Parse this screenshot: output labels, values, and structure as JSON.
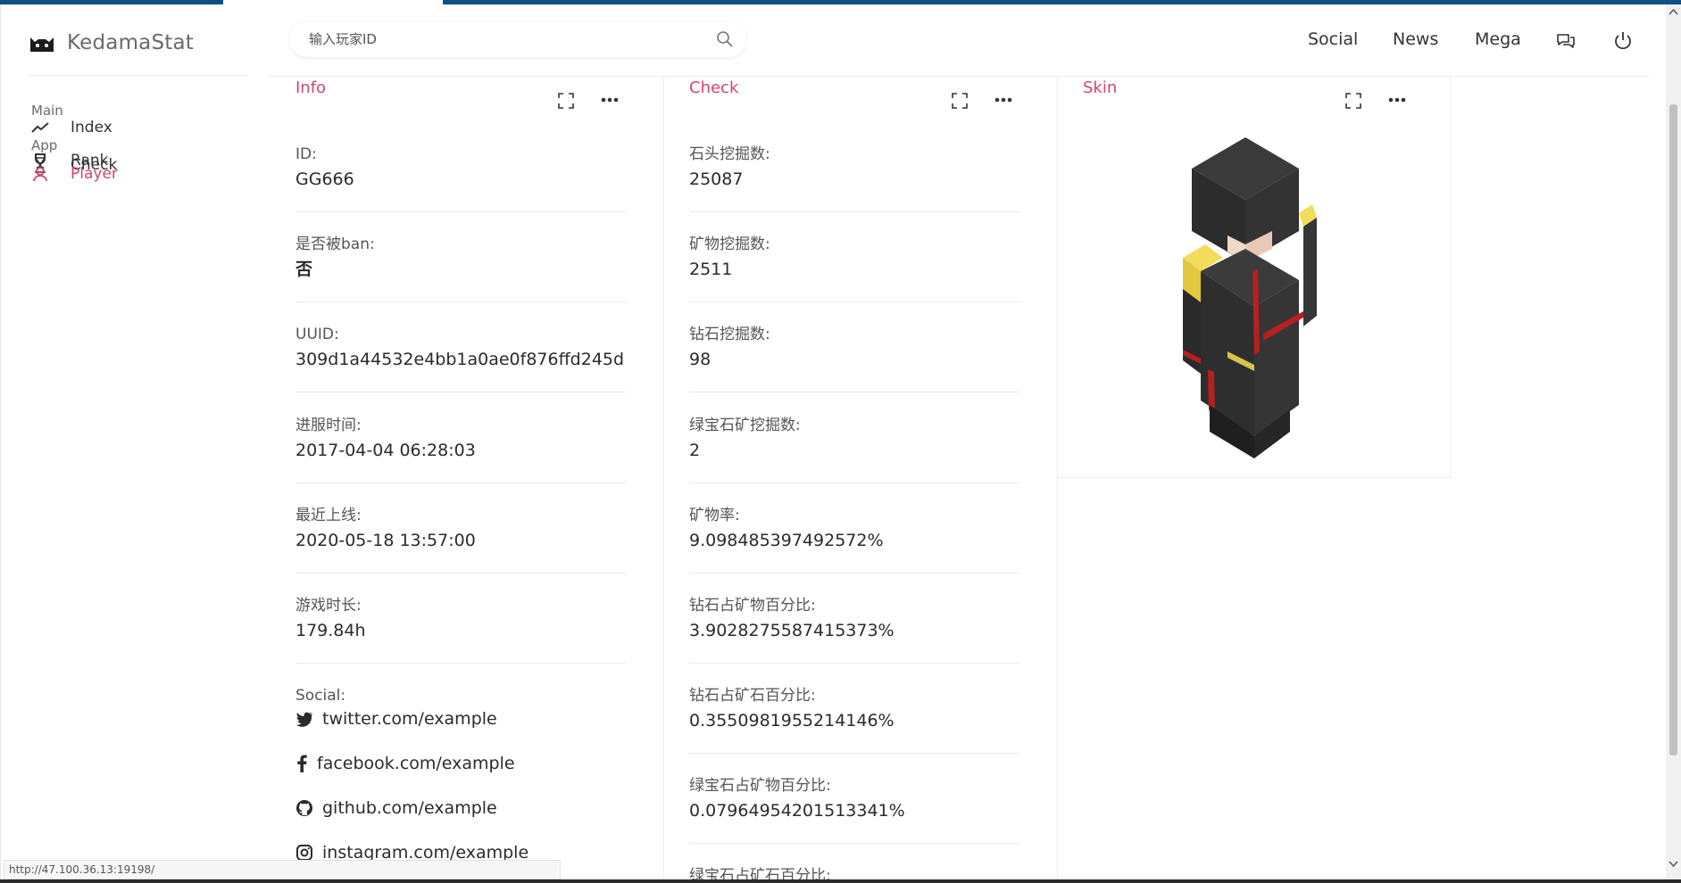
{
  "brand": {
    "name": "KedamaStat"
  },
  "sidebar": {
    "sections": [
      {
        "heading": "Main",
        "items": [
          {
            "label": "Index",
            "icon": "trend-line-icon",
            "active": false
          }
        ]
      },
      {
        "heading": "App",
        "items": [
          {
            "label": "Rank",
            "icon": "trophy-icon",
            "active": false
          },
          {
            "label": "Check",
            "icon": "hourglass-icon",
            "active": false
          },
          {
            "label": "Player",
            "icon": "player-icon",
            "active": true
          }
        ]
      }
    ]
  },
  "header": {
    "search_placeholder": "输入玩家ID",
    "nav": [
      "Social",
      "News",
      "Mega"
    ],
    "icons": [
      "chat-icon",
      "power-icon"
    ]
  },
  "info_panel": {
    "title": "Info",
    "fields": [
      {
        "label": "ID:",
        "value": "GG666"
      },
      {
        "label": "是否被ban:",
        "value": "否"
      },
      {
        "label": "UUID:",
        "value": "309d1a44532e4bb1a0ae0f876ffd245d"
      },
      {
        "label": "进服时间:",
        "value": "2017-04-04 06:28:03"
      },
      {
        "label": "最近上线:",
        "value": "2020-05-18 13:57:00"
      },
      {
        "label": "游戏时长:",
        "value": "179.84h"
      }
    ],
    "social_label": "Social:",
    "social_links": [
      {
        "icon": "twitter-icon",
        "text": "twitter.com/example"
      },
      {
        "icon": "facebook-icon",
        "text": "facebook.com/example"
      },
      {
        "icon": "github-icon",
        "text": "github.com/example"
      },
      {
        "icon": "instagram-icon",
        "text": "instagram.com/example"
      }
    ]
  },
  "check_panel": {
    "title": "Check",
    "fields": [
      {
        "label": "石头挖掘数:",
        "value": "25087"
      },
      {
        "label": "矿物挖掘数:",
        "value": "2511"
      },
      {
        "label": "钻石挖掘数:",
        "value": "98"
      },
      {
        "label": "绿宝石矿挖掘数:",
        "value": "2"
      },
      {
        "label": "矿物率:",
        "value": "9.098485397492572%"
      },
      {
        "label": "钻石占矿物百分比:",
        "value": "3.9028275587415373%"
      },
      {
        "label": "钻石占矿石百分比:",
        "value": "0.3550981955214146%"
      },
      {
        "label": "绿宝石占矿物百分比:",
        "value": "0.07964954201513341%"
      },
      {
        "label": "绿宝石占矿石百分比:",
        "value": ""
      }
    ]
  },
  "skin_panel": {
    "title": "Skin"
  },
  "status_url": "http://47.100.36.13:19198/",
  "colors": {
    "accent": "#d2456f",
    "topbar": "#0d4f86"
  }
}
